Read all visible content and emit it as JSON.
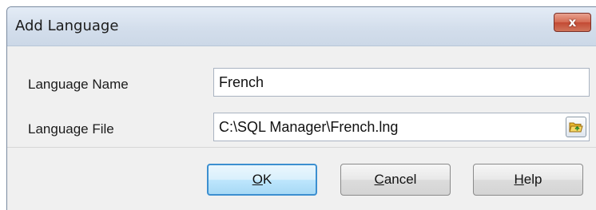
{
  "window": {
    "title": "Add Language",
    "close_glyph": "x"
  },
  "form": {
    "language_name": {
      "label": "Language Name",
      "value": "French"
    },
    "language_file": {
      "label": "Language File",
      "value": "C:\\SQL Manager\\French.lng",
      "browse_icon": "open-folder-icon"
    }
  },
  "buttons": {
    "ok": {
      "mnemonic": "O",
      "rest": "K"
    },
    "cancel": {
      "mnemonic": "C",
      "rest": "ancel"
    },
    "help": {
      "mnemonic": "H",
      "rest": "elp"
    }
  },
  "colors": {
    "title_bar": "#d2ddeb",
    "close_button": "#d46a52",
    "default_button_border": "#3c8fd0",
    "dialog_background": "#f0f0f0"
  }
}
